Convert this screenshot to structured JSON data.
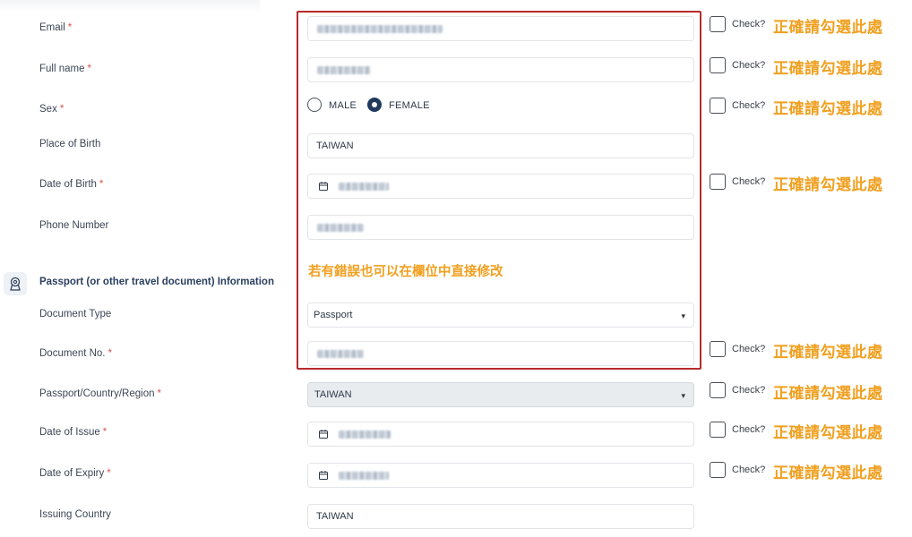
{
  "form": {
    "email": {
      "label": "Email",
      "required": "*"
    },
    "full_name": {
      "label": "Full name",
      "required": "*"
    },
    "sex": {
      "label": "Sex",
      "required": "*",
      "options": [
        "MALE",
        "FEMALE"
      ],
      "selected": "FEMALE"
    },
    "place_of_birth": {
      "label": "Place of Birth",
      "value": "TAIWAN"
    },
    "date_of_birth": {
      "label": "Date of Birth",
      "required": "*"
    },
    "phone_number": {
      "label": "Phone Number"
    }
  },
  "section": {
    "title": "Passport (or other travel document) Information",
    "icon": "passport-badge-icon"
  },
  "passport": {
    "document_type": {
      "label": "Document Type",
      "value": "Passport"
    },
    "document_no": {
      "label": "Document No.",
      "required": "*"
    },
    "country_region": {
      "label": "Passport/Country/Region",
      "required": "*",
      "value": "TAIWAN"
    },
    "date_of_issue": {
      "label": "Date of Issue",
      "required": "*"
    },
    "date_of_expiry": {
      "label": "Date of Expiry",
      "required": "*"
    },
    "issuing_country": {
      "label": "Issuing Country",
      "value": "TAIWAN"
    }
  },
  "annotation": {
    "edit_note": "若有錯誤也可以在欄位中直接修改",
    "check_label": "Check?",
    "check_hint": "正確請勾選此處",
    "highlight_color": "#b92b2b",
    "hint_color": "#f0a020"
  },
  "theme": {
    "selected_radio": "#1f3a5c",
    "required_marker": "#d9534f"
  }
}
